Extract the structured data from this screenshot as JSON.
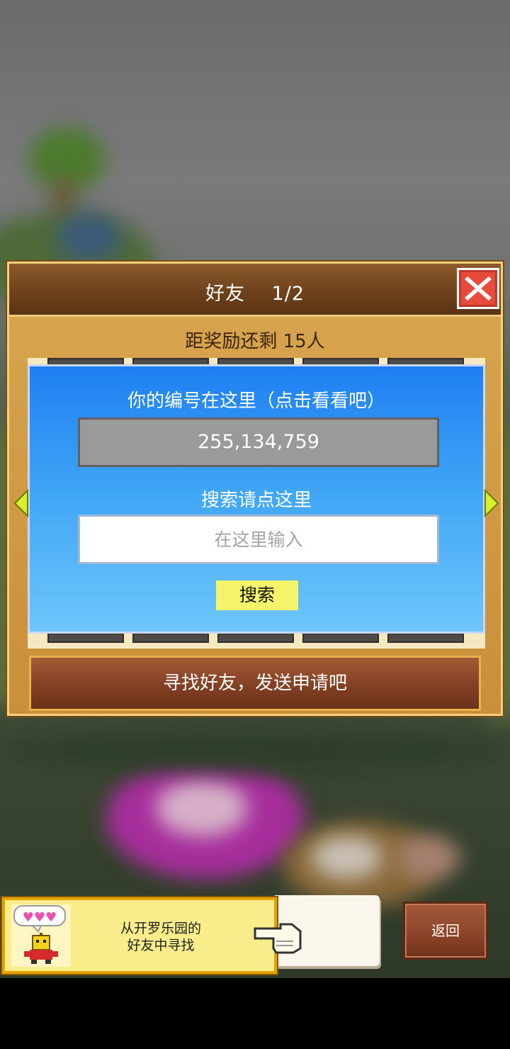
{
  "dialog": {
    "title": "好友　 1/2",
    "reward_text": "距奖励还剩 15人",
    "id_label": "你的编号在这里（点击看看吧）",
    "id_value": "255,134,759",
    "search_label": "搜索请点这里",
    "search_placeholder": "在这里输入",
    "search_button": "搜索",
    "find_friends_button": "寻找好友，发送申请吧"
  },
  "banner": {
    "line1": "从开罗乐园的",
    "line2": "好友中寻找"
  },
  "back_button": "返回",
  "colors": {
    "close_button": "#e74b3c",
    "card_blue": "#1f7ff2",
    "search_button": "#f4f46a",
    "banner_yellow": "#f8ec8b"
  },
  "icons": [
    "close-icon",
    "left-arrow-icon",
    "right-arrow-icon",
    "heart-bubble-icon",
    "robot-mascot-icon",
    "pointing-hand-icon"
  ]
}
